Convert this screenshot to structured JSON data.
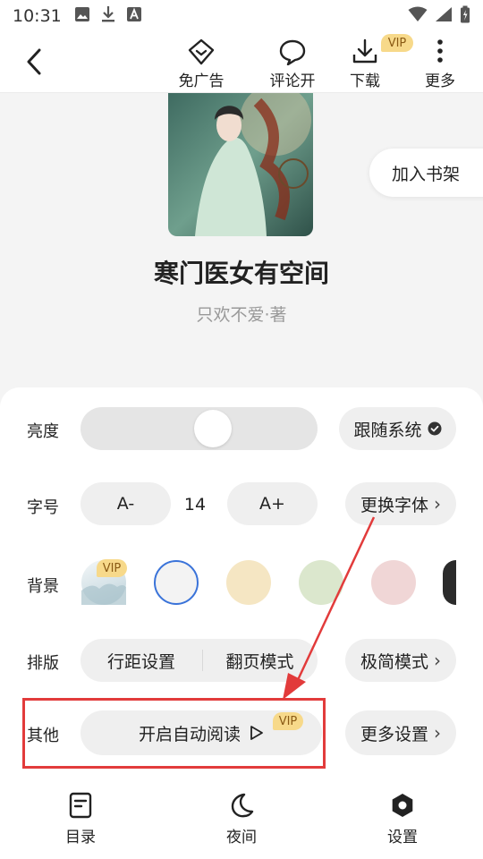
{
  "status_bar": {
    "time": "10:31",
    "left_icons": [
      "image-icon",
      "download-icon",
      "a-icon"
    ],
    "right_icons": [
      "wifi-icon",
      "signal-icon",
      "battery-icon"
    ]
  },
  "top_bar": {
    "back_icon": "back-arrow-icon",
    "actions": [
      {
        "label": "免广告",
        "icon": "ad-free-icon"
      },
      {
        "label": "评论开",
        "icon": "comment-icon"
      },
      {
        "label": "下载",
        "icon": "download-icon"
      },
      {
        "label": "更多",
        "icon": "more-icon"
      }
    ],
    "vip_badge": "VIP"
  },
  "book": {
    "title": "寒门医女有空间",
    "author": "只欢不爱·著",
    "add_shelf_label": "加入书架"
  },
  "settings": {
    "brightness": {
      "label": "亮度",
      "level": 0.57,
      "follow_system_label": "跟随系统"
    },
    "font_size": {
      "label": "字号",
      "decrease_label": "A-",
      "value": "14",
      "increase_label": "A+",
      "change_font_label": "更换字体"
    },
    "background": {
      "label": "背景",
      "vip_badge": "VIP",
      "swatches": [
        "#dde6ea",
        "#f3f3f3",
        "#f5e6c3",
        "#dbe7cd",
        "#f0d6d6",
        "#2b2b2b"
      ],
      "selected_index": 1
    },
    "layout": {
      "label": "排版",
      "line_spacing_label": "行距设置",
      "page_turn_label": "翻页模式",
      "minimal_mode_label": "极简模式"
    },
    "other": {
      "label": "其他",
      "auto_read_label": "开启自动阅读",
      "vip_badge": "VIP",
      "more_settings_label": "更多设置"
    }
  },
  "bottom_nav": [
    {
      "label": "目录",
      "icon": "catalog-icon"
    },
    {
      "label": "夜间",
      "icon": "moon-icon"
    },
    {
      "label": "设置",
      "icon": "settings-icon"
    }
  ],
  "colors": {
    "vip_bg": "#f7d98a",
    "annotation_red": "#e23b3b",
    "selected_ring": "#3a73d9"
  }
}
